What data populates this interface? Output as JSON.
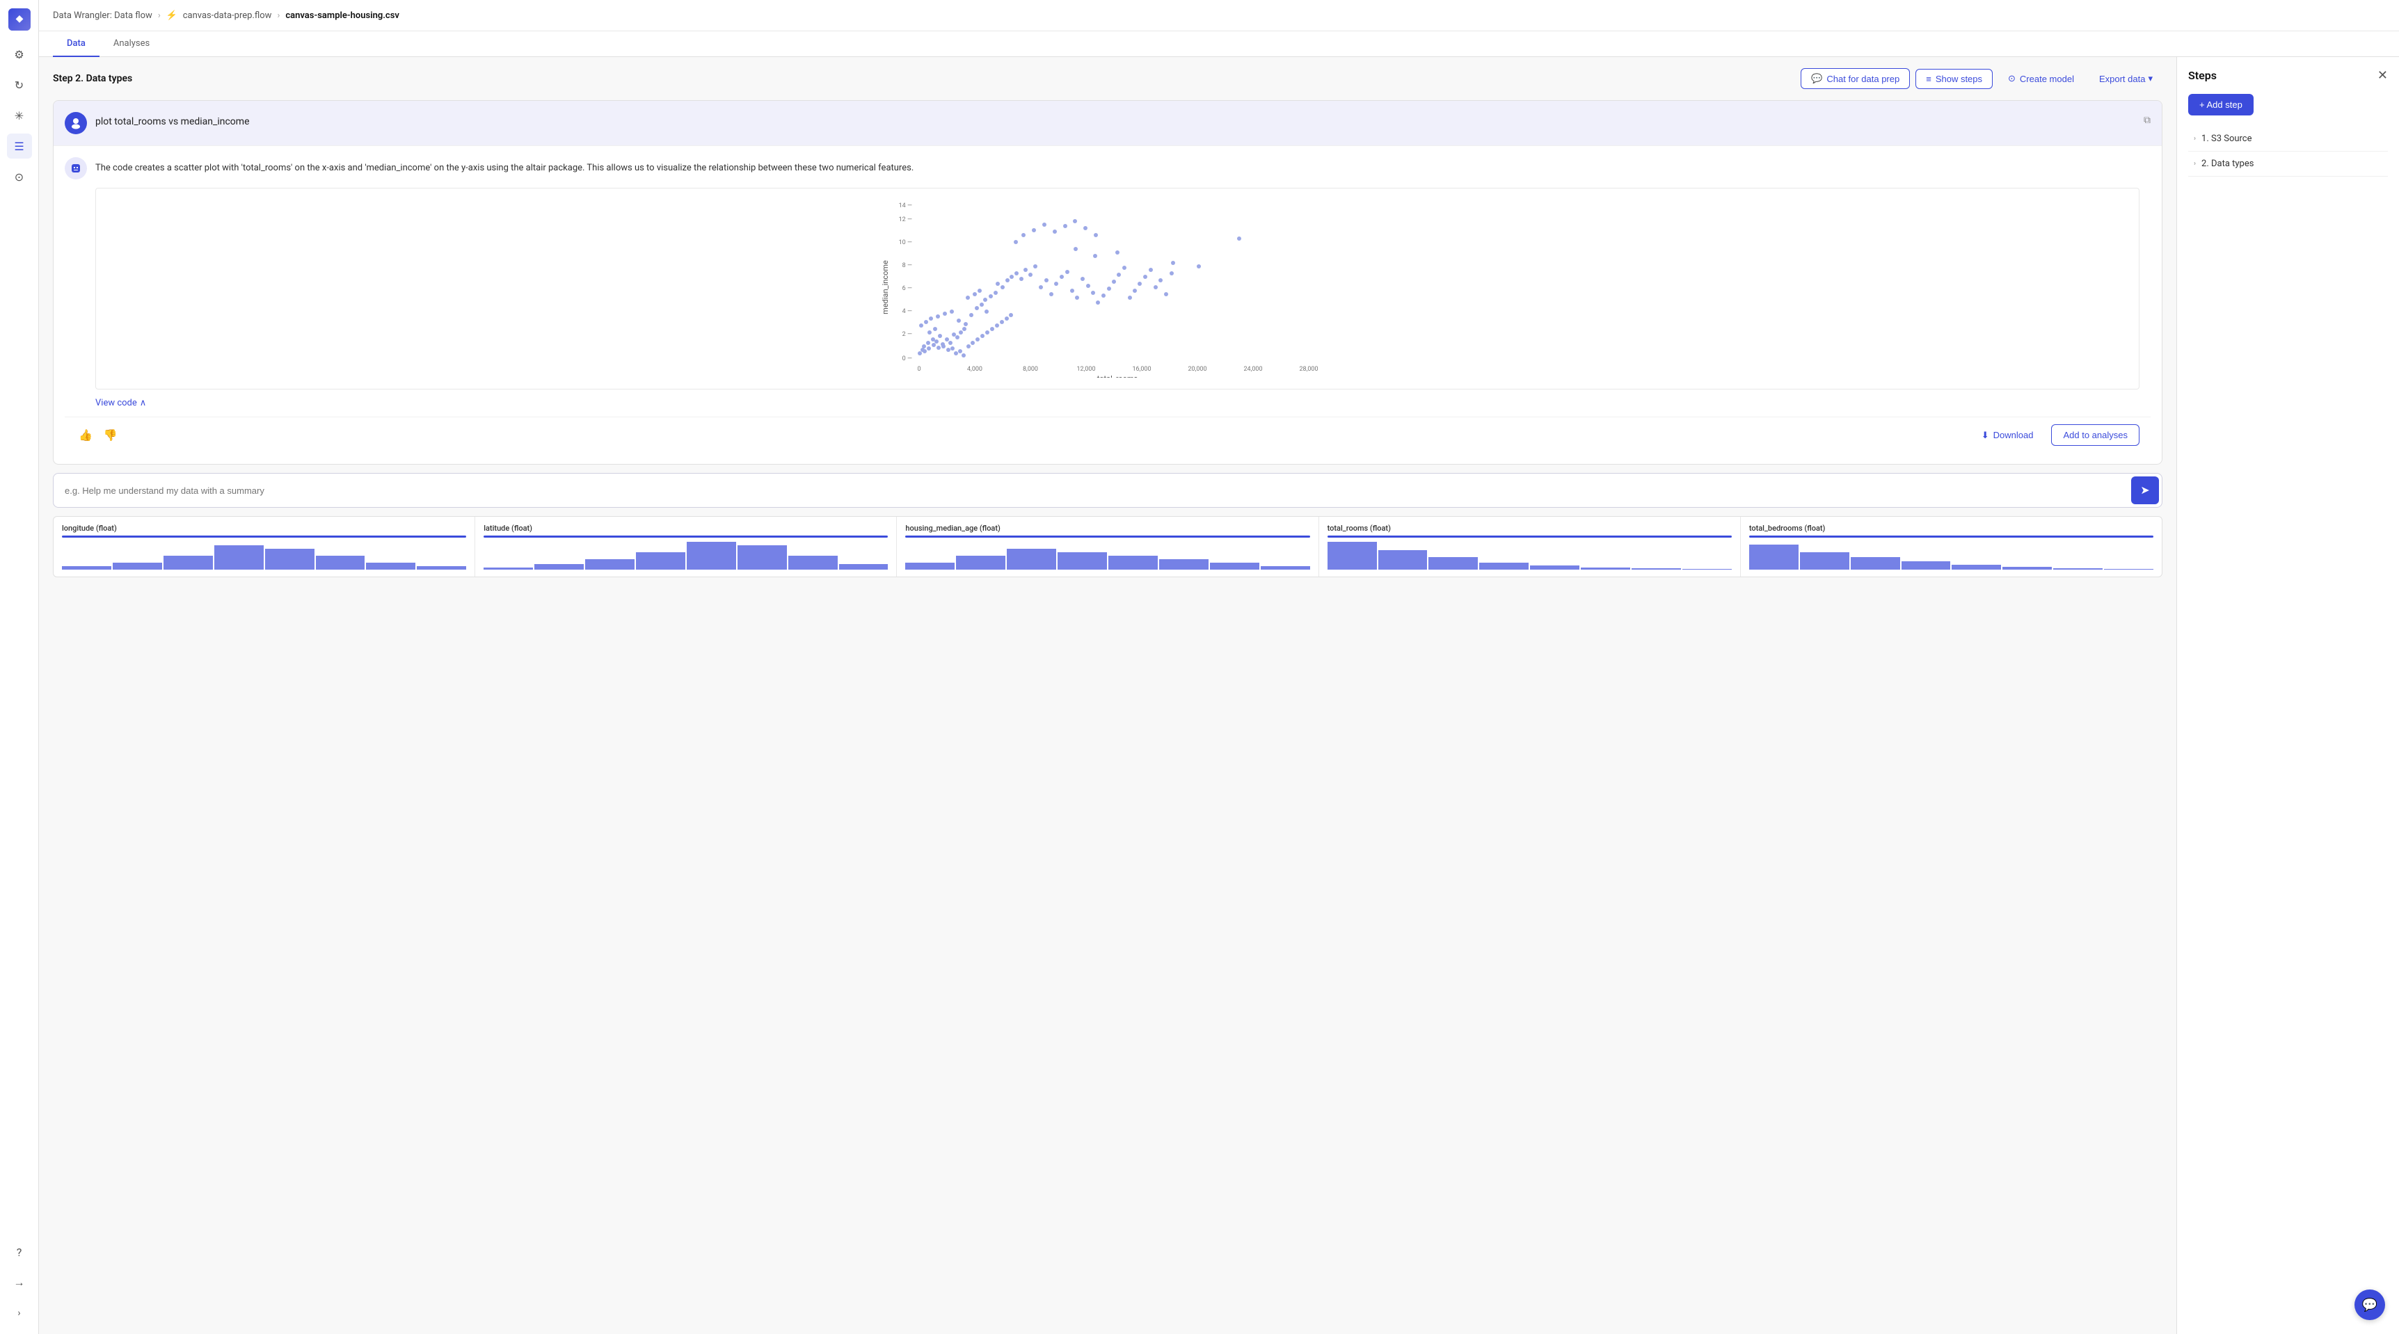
{
  "breadcrumb": {
    "root": "Data Wrangler: Data flow",
    "file": "canvas-data-prep.flow",
    "csv": "canvas-sample-housing.csv"
  },
  "tabs": {
    "data": "Data",
    "analyses": "Analyses"
  },
  "step": {
    "title": "Step 2. Data types"
  },
  "toolbar": {
    "chat_label": "Chat for data prep",
    "show_steps_label": "Show steps",
    "create_model_label": "Create model",
    "export_data_label": "Export data"
  },
  "chat": {
    "user_message": "plot total_rooms vs median_income",
    "ai_response": "The code creates a scatter plot with 'total_rooms' on the x-axis and 'median_income' on the y-axis using the altair package. This allows us to visualize the relationship between these two numerical features.",
    "input_placeholder": "e.g. Help me understand my data with a summary"
  },
  "chart": {
    "x_label": "total_rooms",
    "y_label": "median_income",
    "x_ticks": [
      "0",
      "4,000",
      "8,000",
      "12,000",
      "16,000",
      "20,000",
      "24,000",
      "28,000"
    ],
    "y_ticks": [
      "0 —",
      "2 —",
      "4 —",
      "6 —",
      "8 —",
      "10 —",
      "12 —",
      "14 —"
    ]
  },
  "actions": {
    "view_code": "View code",
    "download": "Download",
    "add_to_analyses": "Add to analyses"
  },
  "steps_panel": {
    "title": "Steps",
    "add_step_label": "+ Add step",
    "steps": [
      {
        "id": 1,
        "label": "1. S3 Source"
      },
      {
        "id": 2,
        "label": "2. Data types"
      }
    ]
  },
  "columns": [
    {
      "name": "longitude (float)",
      "bars": [
        5,
        10,
        20,
        35,
        30,
        20,
        10,
        5
      ]
    },
    {
      "name": "latitude (float)",
      "bars": [
        3,
        8,
        15,
        25,
        40,
        35,
        20,
        8
      ]
    },
    {
      "name": "housing_median_age (float)",
      "bars": [
        10,
        20,
        30,
        25,
        20,
        15,
        10,
        5
      ]
    },
    {
      "name": "total_rooms (float)",
      "bars": [
        35,
        28,
        18,
        10,
        6,
        3,
        2,
        1
      ]
    },
    {
      "name": "total_bedrooms (float)",
      "bars": [
        30,
        25,
        18,
        12,
        7,
        4,
        2,
        1
      ]
    }
  ],
  "icons": {
    "logo": "◆",
    "settings": "⚙",
    "refresh": "↻",
    "asterisk": "✳",
    "list": "☰",
    "circles": "⊙",
    "help": "?",
    "signout": "→",
    "expand": "›",
    "chat_msg": "💬",
    "show_steps": "≡",
    "create_model": "⊙",
    "send": "➤",
    "thumb_up": "👍",
    "thumb_down": "👎",
    "copy": "⧉",
    "chevron_right": "›",
    "chevron_up": "∧",
    "download": "⬇",
    "close": "✕"
  }
}
